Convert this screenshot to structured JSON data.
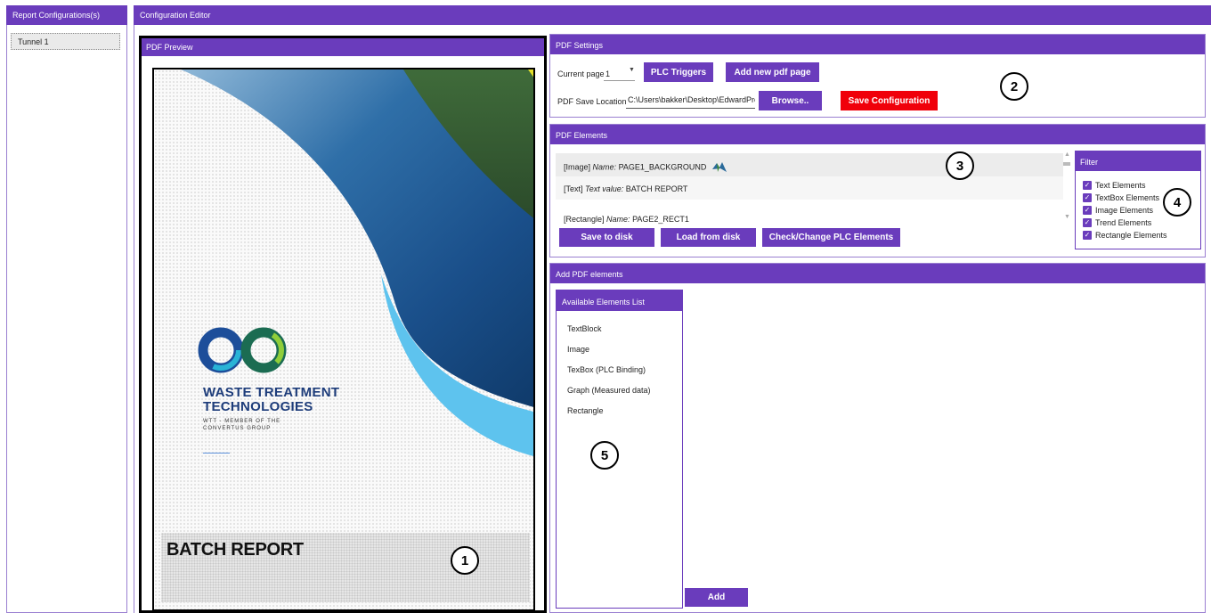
{
  "left": {
    "header": "Report Configurations(s)",
    "items": [
      "Tunnel 1"
    ]
  },
  "main": {
    "header": "Configuration Editor"
  },
  "preview": {
    "header": "PDF Preview",
    "company_name_line1": "WASTE TREATMENT",
    "company_name_line2": "TECHNOLOGIES",
    "company_sub_line1": "WTT - MEMBER OF THE",
    "company_sub_line2": "CONVERTUS GROUP",
    "batch_title": "BATCH REPORT"
  },
  "settings": {
    "header": "PDF Settings",
    "current_page_label": "Current page",
    "current_page_value": "1",
    "plc_triggers": "PLC Triggers",
    "add_page": "Add new pdf page",
    "save_location_label": "PDF Save Location",
    "save_location_value": "C:\\Users\\bakker\\Desktop\\EdwardProjе",
    "browse": "Browse..",
    "save_config": "Save Configuration"
  },
  "elements": {
    "header": "PDF Elements",
    "rows": [
      {
        "type": "[Image]",
        "key": "Name:",
        "value": "PAGE1_BACKGROUND"
      },
      {
        "type": "[Text]",
        "key": "Text value:",
        "value": "BATCH REPORT"
      },
      {
        "type": "[Rectangle]",
        "key": "Name:",
        "value": "PAGE2_RECT1"
      }
    ],
    "save_disk": "Save to disk",
    "load_disk": "Load from disk",
    "check_plc": "Check/Change PLC Elements"
  },
  "filter": {
    "header": "Filter",
    "items": [
      "Text Elements",
      "TextBox Elements",
      "Image Elements",
      "Trend Elements",
      "Rectangle Elements"
    ]
  },
  "add": {
    "header": "Add PDF elements",
    "list_header": "Available Elements List",
    "items": [
      "TextBlock",
      "Image",
      "TexBox (PLC Binding)",
      "Graph (Measured data)",
      "Rectangle"
    ],
    "add_button": "Add"
  },
  "badges": [
    "1",
    "2",
    "3",
    "4",
    "5"
  ],
  "colors": {
    "accent": "#6a3cbc",
    "danger": "#f0000a"
  }
}
